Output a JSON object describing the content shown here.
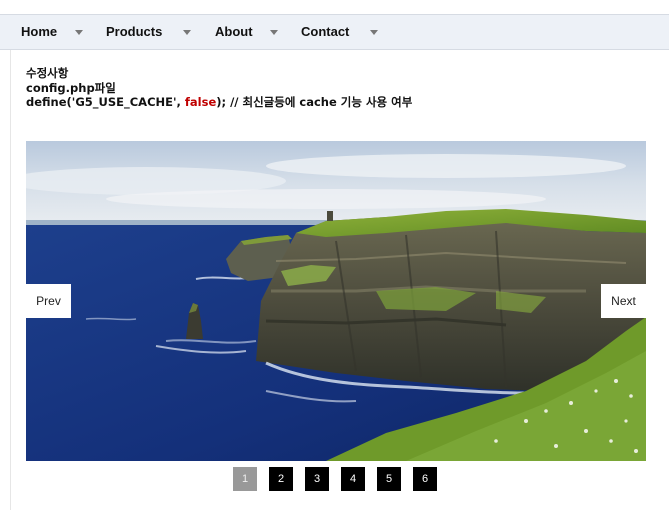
{
  "nav": {
    "items": [
      {
        "label": "Home"
      },
      {
        "label": "Products"
      },
      {
        "label": "About"
      },
      {
        "label": "Contact"
      }
    ]
  },
  "notes": {
    "line1": "수정사항",
    "line2": "config.php파일",
    "line3_prefix": "define('G5_USE_CACHE', ",
    "line3_keyword": "false",
    "line3_suffix": "); // 최신글등에 cache 기능 사용 여부"
  },
  "slider": {
    "prev_label": "Prev",
    "next_label": "Next",
    "image_subject": "sea-cliffs-coastline",
    "pages": [
      "1",
      "2",
      "3",
      "4",
      "5",
      "6"
    ],
    "active_page": "1"
  },
  "colors": {
    "nav_bg": "#edf1f7",
    "keyword_red": "#c00000",
    "pager_bg": "#000000",
    "pager_active_bg": "#999999"
  }
}
